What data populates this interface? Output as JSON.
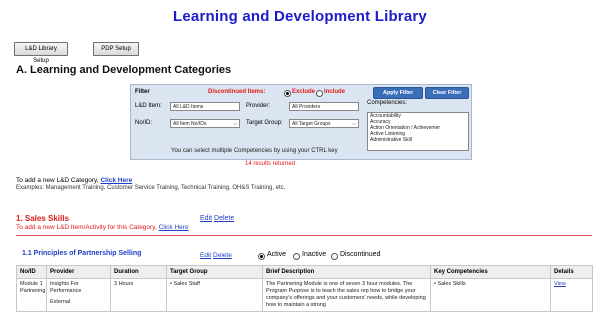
{
  "title": "Learning and Development Library",
  "top_buttons": [
    {
      "label": "L&D Library Setup"
    },
    {
      "label": "PDP Setup"
    }
  ],
  "section_heading": "A. Learning and Development Categories",
  "filter": {
    "title": "Filter",
    "discontinued_label": "Discontinued Items:",
    "exclude_label": "Exclude",
    "include_label": "Include",
    "apply_label": "Apply Filter",
    "clear_label": "Clear Filter",
    "ld_item_label": "L&D Item:",
    "ld_item_value": "All L&D Items",
    "provider_label": "Provider:",
    "provider_value": "All Providers",
    "no_id_label": "No/ID:",
    "no_id_value": "All Item No/IDs",
    "target_group_label": "Target Group:",
    "target_group_value": "All Target Groups",
    "competencies_label": "Competencies:",
    "competencies": [
      "Accountability",
      "Accuracy",
      "Action Orientation / Achievemer",
      "Active Listening",
      "Administrative Skill"
    ],
    "hint": "You can select multiple Competencies by using your CTRL key"
  },
  "results_text": "14 results returned",
  "add_category": {
    "prefix": "To add a new L&D Category,",
    "link": "Click Here",
    "examples": "Examples: Management Training, Customer Service Training, Technical Training, OH&S Training, etc."
  },
  "category": {
    "heading": "1. Sales Skills",
    "edit": "Edit",
    "delete": "Delete",
    "sub_prefix": "To add a new L&D Item/Activity for this Category,",
    "sub_link": "Click Here"
  },
  "item": {
    "heading": "1.1 Principles of Partnership Selling",
    "edit": "Edit",
    "delete": "Delete",
    "status_options": [
      "Active",
      "Inactive",
      "Discontinued"
    ],
    "status_selected": "Active"
  },
  "table": {
    "headers": [
      "No/ID",
      "Provider",
      "Duration",
      "Target Group",
      "Brief Description",
      "Key Competencies",
      "Details"
    ],
    "row": {
      "no_id": "Module 1 Partnering",
      "provider_1": "Insights For Performance",
      "provider_2": "External",
      "duration": "3 Hours",
      "target_group": "• Sales Staff",
      "description": "The Partnering Module is one of seven 3 hour modules. The Program Purpose is to teach the sales rep how to bridge your company's offerings and your customers' needs, while developing how to maintain a strong",
      "competencies": "• Sales Skills",
      "details": "View"
    }
  }
}
